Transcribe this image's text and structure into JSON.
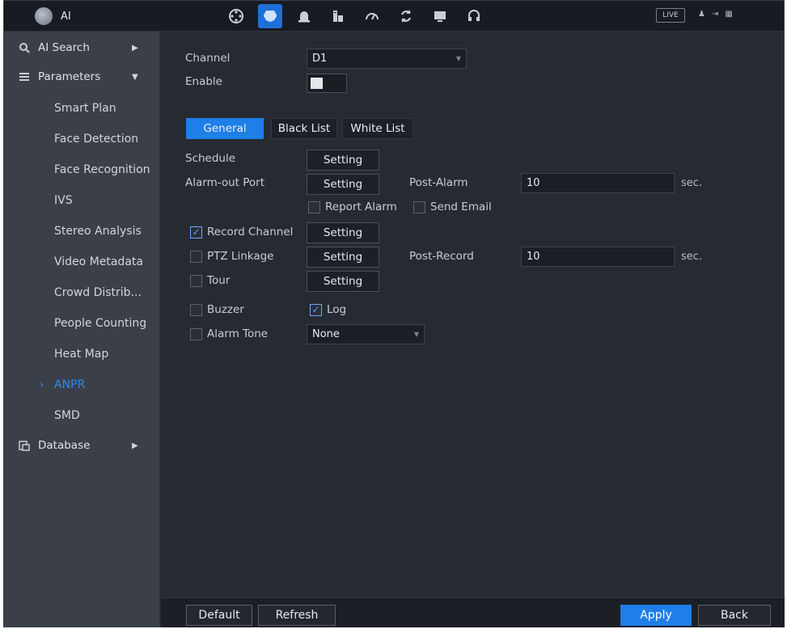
{
  "app": {
    "title": "AI",
    "icon": "ai-brain-icon"
  },
  "topnav": {
    "icons": [
      "playback-reel-icon",
      "ai-brain-icon",
      "alarm-icon",
      "storage-icon",
      "speed-gauge-icon",
      "refresh-icon",
      "display-icon",
      "headset-icon"
    ],
    "active_index": 1,
    "live_label": "LIVE",
    "right_icons": [
      "user-icon",
      "logout-icon",
      "grid-icon"
    ]
  },
  "sidebar": {
    "ai_search": {
      "label": "AI Search",
      "icon": "search-icon"
    },
    "parameters": {
      "label": "Parameters",
      "icon": "list-icon"
    },
    "items": [
      {
        "label": "Smart Plan"
      },
      {
        "label": "Face Detection"
      },
      {
        "label": "Face Recognition"
      },
      {
        "label": "IVS"
      },
      {
        "label": "Stereo Analysis"
      },
      {
        "label": "Video Metadata"
      },
      {
        "label": "Crowd Distrib..."
      },
      {
        "label": "People Counting"
      },
      {
        "label": "Heat Map"
      },
      {
        "label": "ANPR"
      },
      {
        "label": "SMD"
      }
    ],
    "active_item": "ANPR",
    "database": {
      "label": "Database",
      "icon": "database-icon"
    }
  },
  "form": {
    "channel_label": "Channel",
    "channel_value": "D1",
    "enable_label": "Enable",
    "enable_on": false,
    "tabs": [
      {
        "label": "General",
        "active": true
      },
      {
        "label": "Black List",
        "active": false
      },
      {
        "label": "White List",
        "active": false
      }
    ],
    "schedule_label": "Schedule",
    "setting_label": "Setting",
    "alarm_out_label": "Alarm-out Port",
    "post_alarm_label": "Post-Alarm",
    "post_alarm_value": "10",
    "sec_label": "sec.",
    "report_alarm_label": "Report Alarm",
    "report_alarm_checked": false,
    "send_email_label": "Send Email",
    "send_email_checked": false,
    "record_channel_label": "Record Channel",
    "record_channel_checked": true,
    "ptz_label": "PTZ Linkage",
    "ptz_checked": false,
    "post_record_label": "Post-Record",
    "post_record_value": "10",
    "tour_label": "Tour",
    "tour_checked": false,
    "buzzer_label": "Buzzer",
    "buzzer_checked": false,
    "log_label": "Log",
    "log_checked": true,
    "alarm_tone_label": "Alarm Tone",
    "alarm_tone_checked": false,
    "alarm_tone_value": "None"
  },
  "footer": {
    "default_label": "Default",
    "refresh_label": "Refresh",
    "apply_label": "Apply",
    "back_label": "Back"
  },
  "colors": {
    "accent": "#1f7ee8",
    "active_text": "#2f88f0",
    "background": "#262a33",
    "sidebar": "#3a3f48"
  }
}
